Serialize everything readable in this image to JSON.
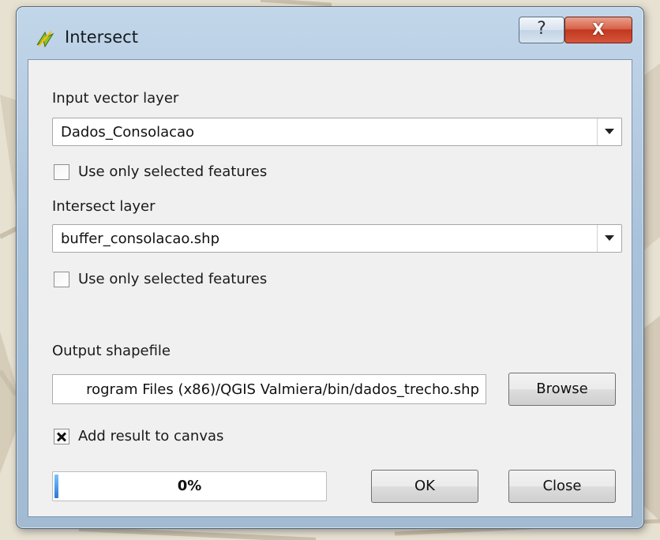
{
  "window": {
    "title": "Intersect",
    "help_glyph": "?",
    "close_glyph": "X"
  },
  "input_layer": {
    "label": "Input vector layer",
    "value": "Dados_Consolacao",
    "selected_only_label": "Use only selected features",
    "selected_only_checked": false
  },
  "intersect_layer": {
    "label": "Intersect layer",
    "value": "buffer_consolacao.shp",
    "selected_only_label": "Use only selected features",
    "selected_only_checked": false
  },
  "output": {
    "label": "Output shapefile",
    "path": "rogram Files (x86)/QGIS Valmiera/bin/dados_trecho.shp",
    "browse_label": "Browse",
    "add_to_canvas_label": "Add result to canvas",
    "add_to_canvas_checked": true
  },
  "progress": {
    "value": 0,
    "text": "0%"
  },
  "buttons": {
    "ok_label": "OK",
    "close_label": "Close"
  },
  "colors": {
    "window_frame": "#a9c2db",
    "close_button": "#c0391f",
    "progress_fill": "#2a78d6"
  }
}
